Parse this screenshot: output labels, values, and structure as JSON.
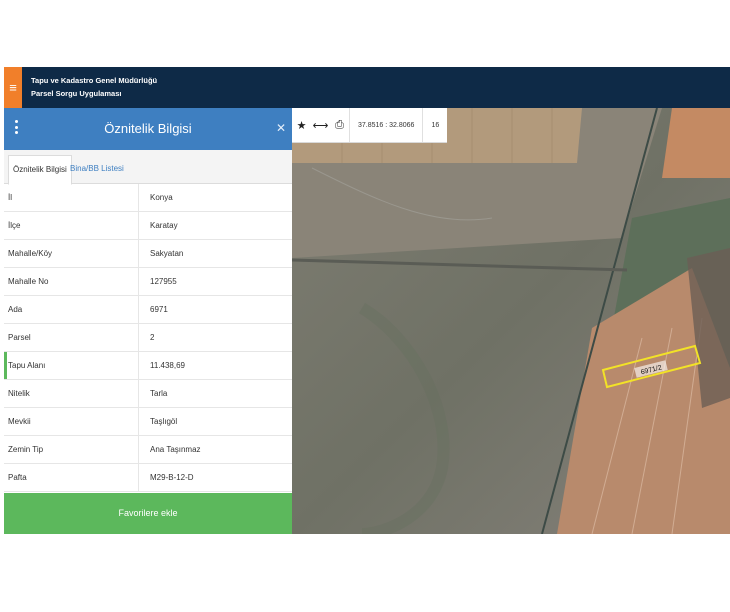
{
  "header": {
    "org_title": "Tapu ve Kadastro Genel Müdürlüğü",
    "app_title": "Parsel Sorgu Uygulaması",
    "menu_icon": "≡"
  },
  "panel": {
    "title": "Öznitelik Bilgisi",
    "close_icon": "✕",
    "tabs": [
      {
        "label": "Öznitelik Bilgisi",
        "active": true
      },
      {
        "label": "Bina/BB Listesi",
        "active": false
      }
    ],
    "rows": [
      {
        "key": "İl",
        "value": "Konya"
      },
      {
        "key": "İlçe",
        "value": "Karatay"
      },
      {
        "key": "Mahalle/Köy",
        "value": "Sakyatan"
      },
      {
        "key": "Mahalle No",
        "value": "127955"
      },
      {
        "key": "Ada",
        "value": "6971"
      },
      {
        "key": "Parsel",
        "value": "2"
      },
      {
        "key": "Tapu Alanı",
        "value": "11.438,69"
      },
      {
        "key": "Nitelik",
        "value": "Tarla"
      },
      {
        "key": "Mevkii",
        "value": "Taşlıgöl"
      },
      {
        "key": "Zemin Tip",
        "value": "Ana Taşınmaz"
      },
      {
        "key": "Pafta",
        "value": "M29-B-12-D"
      }
    ],
    "favorite_button": "Favorilere ekle"
  },
  "map": {
    "toolbar": {
      "star_icon": "★",
      "measure_icon": "⟷",
      "print_icon": "⎙",
      "coordinates": "37.8516 : 32.8066",
      "zoom": "16"
    },
    "parcel_label": "6971/2",
    "parcel_color": "#f2e227"
  }
}
